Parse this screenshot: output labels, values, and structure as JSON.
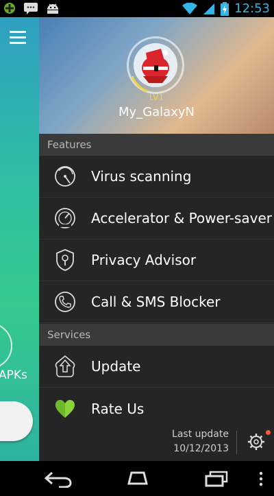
{
  "status_bar": {
    "time": "12:53"
  },
  "background_app": {
    "apks_label": "APKs"
  },
  "drawer": {
    "profile": {
      "level": "LV1",
      "username": "My_GalaxyN"
    },
    "sections": {
      "features": "Features",
      "services": "Services"
    },
    "features": [
      {
        "label": "Virus scanning",
        "icon": "radar-scan-icon"
      },
      {
        "label": "Accelerator & Power-saver",
        "icon": "speedometer-icon"
      },
      {
        "label": "Privacy Advisor",
        "icon": "shield-keyhole-icon"
      },
      {
        "label": "Call & SMS Blocker",
        "icon": "phone-block-icon"
      }
    ],
    "services": [
      {
        "label": "Update",
        "icon": "upload-arrow-icon"
      },
      {
        "label": "Rate Us",
        "icon": "heart-icon"
      }
    ],
    "footer": {
      "last_update_label": "Last update",
      "last_update_date": "10/12/2013"
    }
  },
  "colors": {
    "accent": "#33b5e5",
    "drawer_bg": "#252525",
    "section_bg": "#3a3a3a",
    "heart": "#8ad43a",
    "level": "#f3d33a"
  }
}
